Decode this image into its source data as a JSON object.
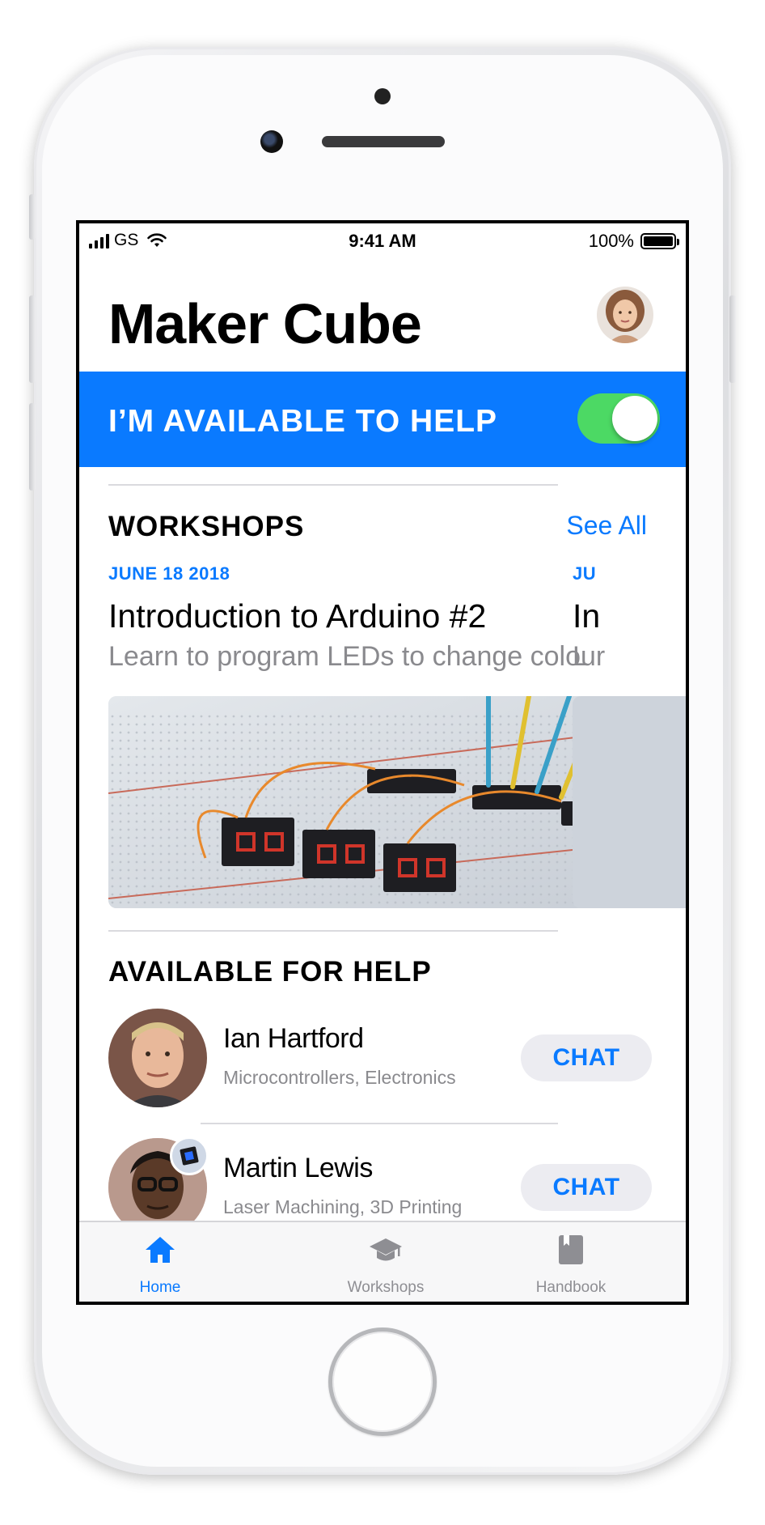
{
  "status_bar": {
    "carrier": "GS",
    "time": "9:41 AM",
    "battery": "100%"
  },
  "header": {
    "title": "Maker Cube"
  },
  "help_banner": {
    "label": "I’M AVAILABLE TO HELP",
    "toggle_on": true,
    "color": "#0a7aff",
    "toggle_color": "#4cd964"
  },
  "workshops": {
    "section_title": "WORKSHOPS",
    "see_all": "See All",
    "cards": [
      {
        "date": "JUNE 18 2018",
        "title": "Introduction to Arduino #2",
        "subtitle": "Learn to program LEDs to change colour"
      },
      {
        "date": "JU",
        "title": "In",
        "subtitle": "L"
      }
    ]
  },
  "helpers": {
    "section_title": "AVAILABLE FOR HELP",
    "items": [
      {
        "name": "Ian Hartford",
        "skills": "Microcontrollers, Electronics",
        "action": "CHAT"
      },
      {
        "name": "Martin Lewis",
        "skills": "Laser Machining, 3D Printing",
        "action": "CHAT"
      }
    ]
  },
  "tab_bar": {
    "tabs": [
      {
        "label": "Home",
        "icon": "house-icon",
        "active": true
      },
      {
        "label": "Workshops",
        "icon": "graduation-cap-icon",
        "active": false
      },
      {
        "label": "Handbook",
        "icon": "book-icon",
        "active": false
      }
    ],
    "active_color": "#0a7aff",
    "inactive_color": "#8e8e93"
  }
}
